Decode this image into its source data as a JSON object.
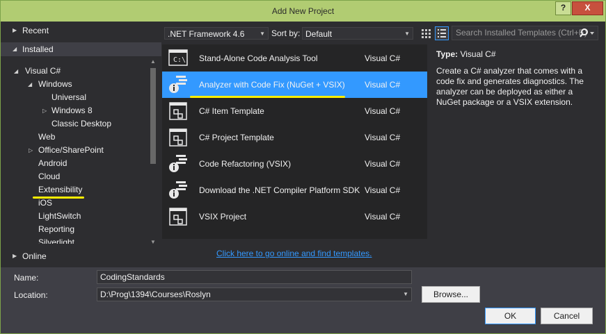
{
  "window": {
    "title": "Add New Project",
    "help_label": "?",
    "close_label": "X"
  },
  "nav": {
    "recent": "Recent",
    "installed": "Installed",
    "online": "Online",
    "tree": [
      {
        "label": "Visual C#",
        "arrow": "◢"
      },
      {
        "label": "Windows",
        "arrow": "◢"
      },
      {
        "label": "Universal",
        "arrow": ""
      },
      {
        "label": "Windows 8",
        "arrow": "▷"
      },
      {
        "label": "Classic Desktop",
        "arrow": ""
      },
      {
        "label": "Web",
        "arrow": ""
      },
      {
        "label": "Office/SharePoint",
        "arrow": "▷"
      },
      {
        "label": "Android",
        "arrow": ""
      },
      {
        "label": "Cloud",
        "arrow": ""
      },
      {
        "label": "Extensibility",
        "arrow": ""
      },
      {
        "label": "iOS",
        "arrow": ""
      },
      {
        "label": "LightSwitch",
        "arrow": ""
      },
      {
        "label": "Reporting",
        "arrow": ""
      },
      {
        "label": "Silverlight",
        "arrow": ""
      }
    ],
    "selected_index": 9
  },
  "toolbar": {
    "framework": ".NET Framework 4.6",
    "sort_label": "Sort by:",
    "sort_value": "Default",
    "search_placeholder": "Search Installed Templates (Ctrl+E)"
  },
  "templates": [
    {
      "name": "Stand-Alone Code Analysis Tool",
      "lang": "Visual C#",
      "icon": "console-app-icon"
    },
    {
      "name": "Analyzer with Code Fix (NuGet + VSIX)",
      "lang": "Visual C#",
      "icon": "analyzer-icon"
    },
    {
      "name": "C# Item Template",
      "lang": "Visual C#",
      "icon": "item-template-icon"
    },
    {
      "name": "C# Project Template",
      "lang": "Visual C#",
      "icon": "project-template-icon"
    },
    {
      "name": "Code Refactoring (VSIX)",
      "lang": "Visual C#",
      "icon": "refactoring-icon"
    },
    {
      "name": "Download the .NET Compiler Platform SDK",
      "lang": "Visual C#",
      "icon": "sdk-download-icon"
    },
    {
      "name": "VSIX Project",
      "lang": "Visual C#",
      "icon": "vsix-icon"
    }
  ],
  "selected_template": 1,
  "details": {
    "type_label": "Type:",
    "type_value": "Visual C#",
    "description": "Create a C# analyzer that comes with a code fix and generates diagnostics. The analyzer can be deployed as either a NuGet package or a VSIX extension."
  },
  "online_link": "Click here to go online and find templates.",
  "form": {
    "name_label": "Name:",
    "name_value": "CodingStandards",
    "location_label": "Location:",
    "location_value": "D:\\Prog\\1394\\Courses\\Roslyn",
    "browse_label": "Browse...",
    "ok_label": "OK",
    "cancel_label": "Cancel"
  },
  "colors": {
    "title_bar": "#b1cc72",
    "selection": "#3399ff",
    "highlight": "#ffee00",
    "background": "#2d2d30"
  }
}
